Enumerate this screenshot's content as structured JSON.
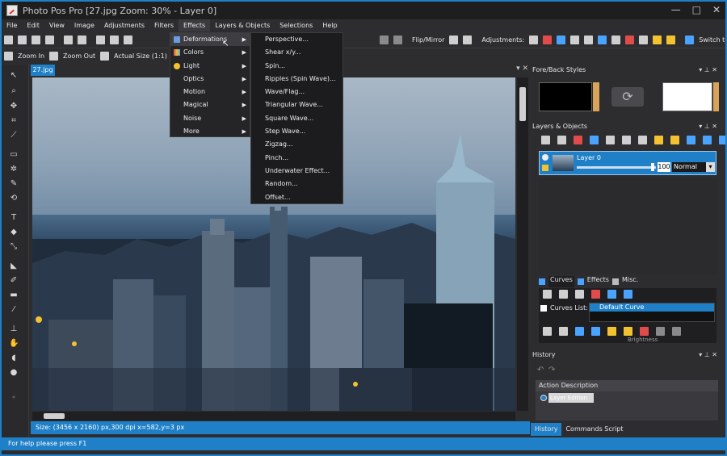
{
  "window": {
    "title": "Photo Pos Pro [27.jpg Zoom: 30% - Layer 0]",
    "controls": [
      "—",
      "□",
      "✕"
    ]
  },
  "menubar": [
    "File",
    "Edit",
    "View",
    "Image",
    "Adjustments",
    "Filters",
    "Effects",
    "Layers & Objects",
    "Selections",
    "Help"
  ],
  "toolbar1": {
    "flip_label": "Flip/Mirror",
    "adjustments_label": "Adjustments:",
    "novice_label": "Switch to Novice Interface"
  },
  "toolbar2": {
    "zoom_in": "Zoom In",
    "zoom_out": "Zoom Out",
    "actual_size": "Actual Size (1:1)"
  },
  "effects_menu": {
    "items": [
      {
        "label": "Deformations",
        "icon": "deformations-icon",
        "color": "#6b9de0"
      },
      {
        "label": "Colors",
        "icon": "colors-icon",
        "color": "#d9534f"
      },
      {
        "label": "Light",
        "icon": "light-icon",
        "color": "#f2c230"
      },
      {
        "label": "Optics",
        "icon": "",
        "color": ""
      },
      {
        "label": "Motion",
        "icon": "",
        "color": ""
      },
      {
        "label": "Magical",
        "icon": "",
        "color": ""
      },
      {
        "label": "Noise",
        "icon": "",
        "color": ""
      },
      {
        "label": "More",
        "icon": "",
        "color": ""
      }
    ],
    "highlighted": "Deformations"
  },
  "deformations_submenu": [
    "Perspective...",
    "Shear x/y...",
    "Spin...",
    "Ripples (Spin Wave)...",
    "Wave/Flag...",
    "Triangular Wave...",
    "Square Wave...",
    "Step Wave...",
    "Zigzag...",
    "Pinch...",
    "Underwater Effect...",
    "Random...",
    "Offset..."
  ],
  "document": {
    "tab": "27.jpg",
    "status": "Size: (3456 x 2160) px,300 dpi    x=582,y=3 px"
  },
  "panels": {
    "foreback": {
      "title": "Fore/Back Styles",
      "fore_color": "#000000",
      "back_color": "#ffffff"
    },
    "layers": {
      "title": "Layers & Objects",
      "layer_name": "Layer 0",
      "opacity": "100",
      "blend_mode": "Normal",
      "tabs": [
        "Curves",
        "Effects",
        "Misc."
      ],
      "curves_list_label": "Curves List:",
      "curve_item": "Default Curve",
      "slider_caption": "Brightness"
    },
    "history": {
      "title": "History",
      "column": "Action Description",
      "entry": "Layer Edition"
    },
    "bottom_tabs": [
      "History",
      "Commands Script"
    ]
  },
  "statusbar": "For help please press F1"
}
